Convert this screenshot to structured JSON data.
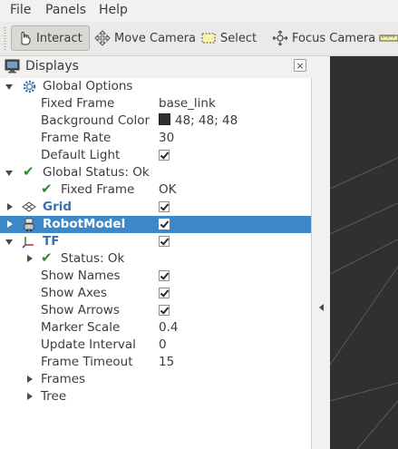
{
  "menu": {
    "file": "File",
    "panels": "Panels",
    "help": "Help"
  },
  "toolbar": {
    "interact": "Interact",
    "move_camera": "Move Camera",
    "select": "Select",
    "focus_camera": "Focus Camera"
  },
  "panel": {
    "title": "Displays",
    "close": "×"
  },
  "tree": {
    "global_options": "Global Options",
    "fixed_frame_label": "Fixed Frame",
    "fixed_frame_value": "base_link",
    "bg_color_label": "Background Color",
    "bg_color_value": "48; 48; 48",
    "frame_rate_label": "Frame Rate",
    "frame_rate_value": "30",
    "default_light_label": "Default Light",
    "global_status": "Global Status: Ok",
    "status_fixed_frame_label": "Fixed Frame",
    "status_fixed_frame_value": "OK",
    "grid": "Grid",
    "robot_model": "RobotModel",
    "tf": "TF",
    "tf_status": "Status: Ok",
    "show_names": "Show Names",
    "show_axes": "Show Axes",
    "show_arrows": "Show Arrows",
    "marker_scale_label": "Marker Scale",
    "marker_scale_value": "0.4",
    "update_interval_label": "Update Interval",
    "update_interval_value": "0",
    "frame_timeout_label": "Frame Timeout",
    "frame_timeout_value": "15",
    "frames": "Frames",
    "tree": "Tree"
  },
  "colors": {
    "background": "#303030",
    "selection": "#3d88c8",
    "ok_check": "#2d8a2d",
    "display_name": "#3d6fb0"
  }
}
